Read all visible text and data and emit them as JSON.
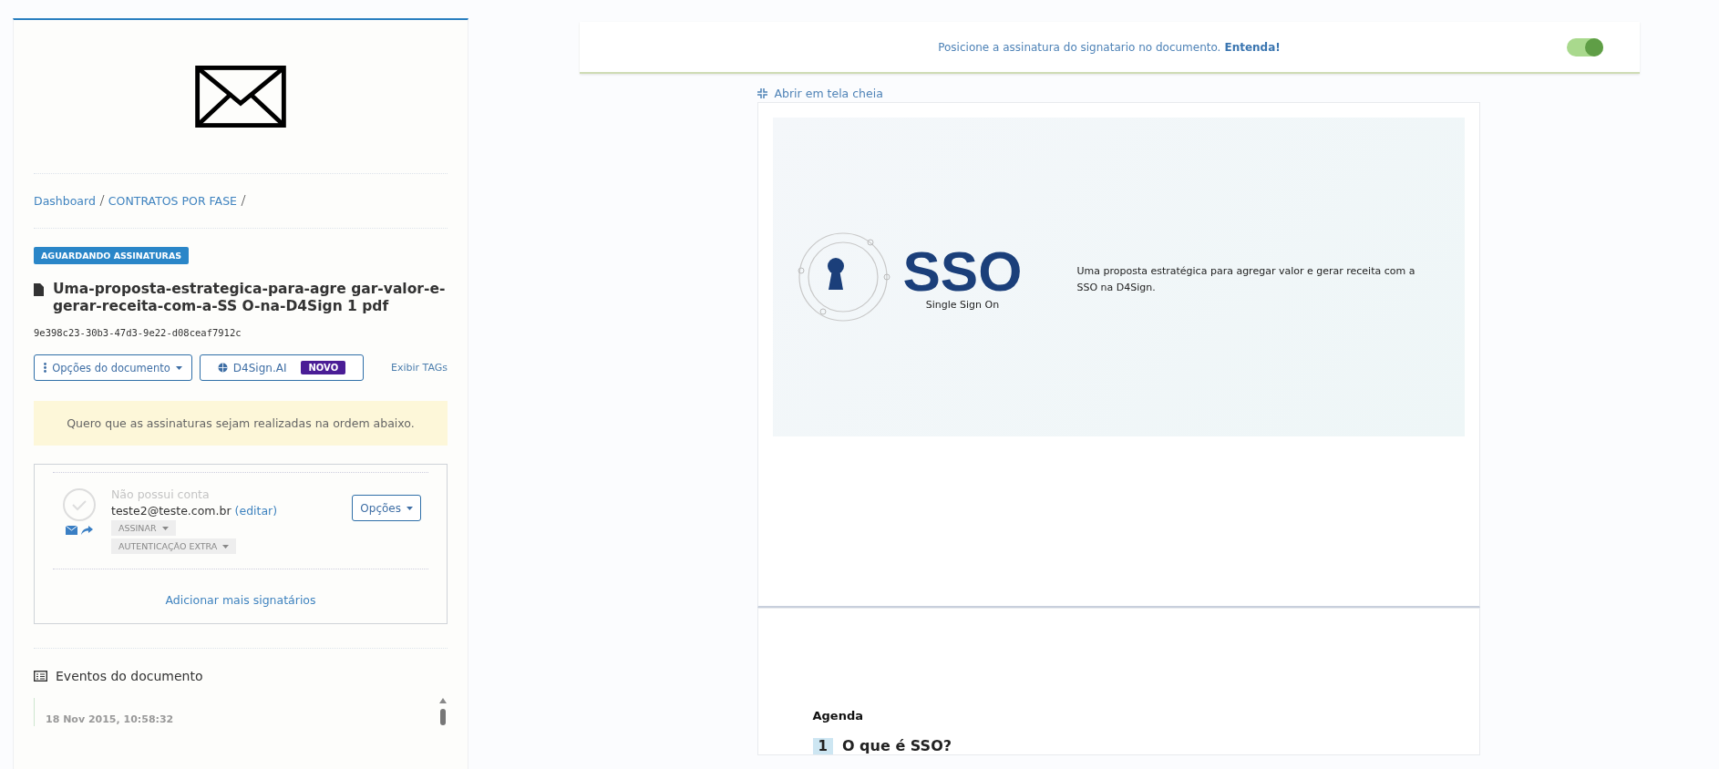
{
  "sidebar": {
    "breadcrumb": [
      {
        "label": "Dashboard"
      },
      {
        "label": "CONTRATOS POR FASE"
      }
    ],
    "status_badge": "AGUARDANDO ASSINATURAS",
    "document_title": "Uma-proposta-estrategica-para-agre gar-valor-e-gerar-receita-com-a-SS O-na-D4Sign 1 pdf",
    "document_hash": "9e398c23-30b3-47d3-9e22-d08ceaf7912c",
    "options_button": "Opções do documento",
    "ai_button": "D4Sign.AI",
    "ai_badge": "NOVO",
    "tags_link": "Exibir TAGs",
    "order_notice": "Quero que as assinaturas sejam realizadas na ordem abaixo.",
    "signers": [
      {
        "account_note": "Não possui conta",
        "email": "teste2@teste.com.br",
        "edit_link": "(editar)",
        "action": "ASSINAR",
        "auth": "AUTENTICAÇÃO EXTRA",
        "options": "Opções"
      }
    ],
    "add_signers": "Adicionar mais signatários",
    "events": {
      "title": "Eventos do documento",
      "items": [
        {
          "date": "18 Nov 2015, 10:58:32"
        }
      ]
    }
  },
  "banner": {
    "text": "Posicione a assinatura do signatario no documento.",
    "link": "Entenda!",
    "toggle_on": true
  },
  "fullscreen_link": "Abrir em tela cheia",
  "document": {
    "logo_title": "SSO",
    "logo_subtitle": "Single Sign On",
    "description": "Uma proposta estratégica para agregar valor e gerar receita com a SSO na D4Sign.",
    "agenda_title": "Agenda",
    "agenda_items": [
      {
        "number": "1",
        "text": "O que é SSO?"
      }
    ]
  }
}
